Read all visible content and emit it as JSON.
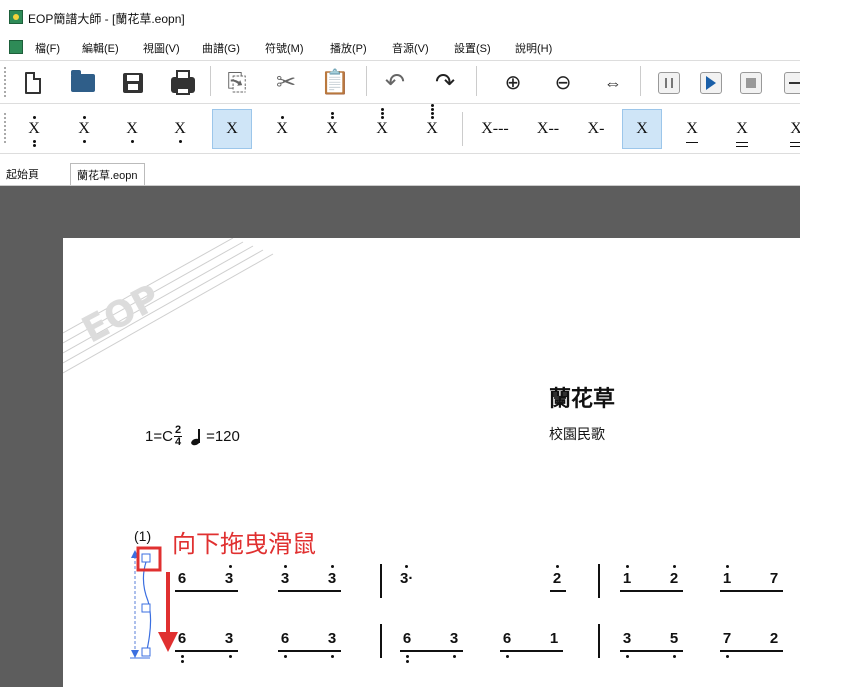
{
  "window": {
    "title": "EOP簡譜大師 - [蘭花草.eopn]"
  },
  "menu": {
    "items": [
      "檔(F)",
      "編輯(E)",
      "視圖(V)",
      "曲譜(G)",
      "符號(M)",
      "播放(P)",
      "音源(V)",
      "設置(S)",
      "說明(H)"
    ]
  },
  "toolbar": {
    "buttons": [
      "new-file",
      "open-folder",
      "save",
      "print",
      "copy",
      "cut",
      "paste",
      "undo",
      "redo",
      "zoom-in",
      "zoom-out",
      "fit-page",
      "pause",
      "play",
      "stop",
      "more"
    ]
  },
  "durations": {
    "glyph": "X",
    "long3": "X---",
    "long2": "X--",
    "long1": "X-"
  },
  "tabs": [
    "起始頁",
    "蘭花草.eopn"
  ],
  "score": {
    "title": "蘭花草",
    "subtitle": "校園民歌",
    "key_prefix": "1=C",
    "time_num": "2",
    "time_den": "4",
    "tempo": "=120",
    "measure_number": "(1)",
    "annotation": "向下拖曳滑鼠",
    "annotation_color": "#e03030",
    "watermark_text": "EOP",
    "row1": [
      "6",
      "3",
      "3",
      "3",
      "3·",
      "2",
      "1",
      "2",
      "1",
      "7"
    ],
    "row2": [
      "6",
      "3",
      "6",
      "3",
      "6",
      "3",
      "6",
      "1",
      "3",
      "5",
      "7",
      "2"
    ]
  },
  "colors": {
    "selected_bg": "#cfe5f7",
    "workspace": "#5d5d5d",
    "accent_blue": "#1a5fa8"
  }
}
